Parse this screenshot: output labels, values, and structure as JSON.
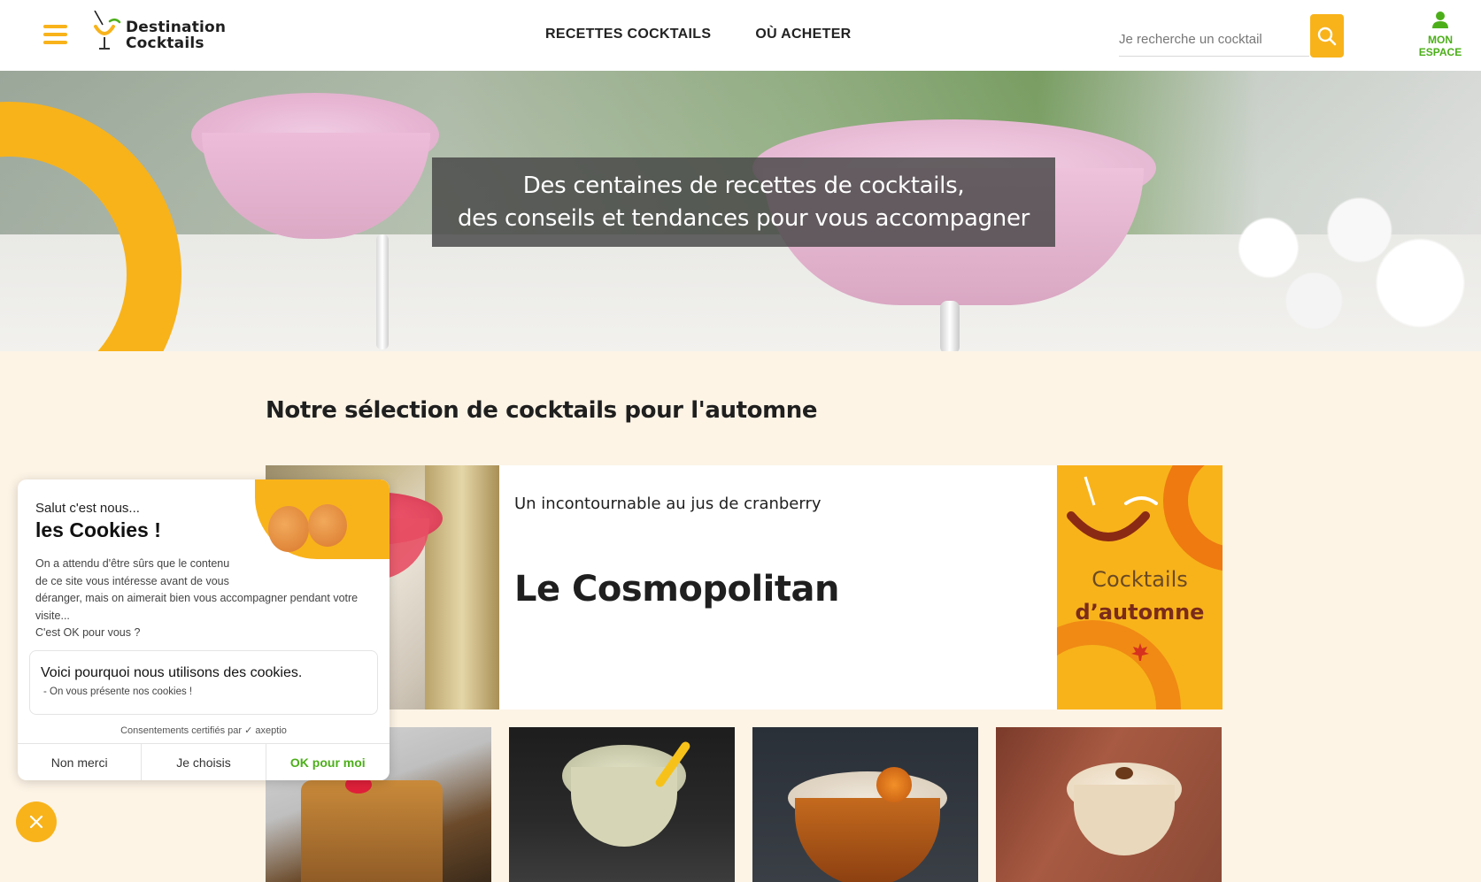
{
  "header": {
    "menu_icon": "hamburger-icon",
    "logo": {
      "line1": "Destination",
      "line2": "Cocktails"
    },
    "nav": [
      {
        "label": "RECETTES COCKTAILS"
      },
      {
        "label": "OÙ ACHETER"
      }
    ],
    "search": {
      "placeholder": "Je recherche un cocktail",
      "value": ""
    },
    "account": {
      "line1": "MON",
      "line2": "ESPACE"
    }
  },
  "hero": {
    "line1": "Des centaines de recettes de cocktails,",
    "line2": "des conseils et tendances pour vous accompagner"
  },
  "selection": {
    "title": "Notre sélection de cocktails pour l'automne",
    "featured": {
      "subtitle": "Un incontournable au jus de cranberry",
      "title": "Le Cosmopolitan"
    },
    "promo": {
      "line1": "Cocktails",
      "line2": "d’automne"
    }
  },
  "cookie": {
    "greeting": "Salut c'est nous...",
    "headline": "les Cookies !",
    "body_line1": "On a attendu d'être sûrs que le contenu",
    "body_line2": "de ce site vous intéresse avant de vous",
    "body_line3": "déranger, mais on aimerait bien vous accompagner pendant votre",
    "body_line4": "visite...",
    "body_line5": "C'est OK pour vous ?",
    "why": "Voici pourquoi nous utilisons des cookies.",
    "presentation": "- On vous présente nos cookies !",
    "certified": "Consentements certifiés par",
    "certifier": "axeptio",
    "buttons": {
      "refuse": "Non merci",
      "choose": "Je choisis",
      "accept": "OK pour moi"
    }
  },
  "colors": {
    "brand_yellow": "#f8b31b",
    "accent_green": "#4caf1a",
    "background_cream": "#fdf4e6"
  }
}
